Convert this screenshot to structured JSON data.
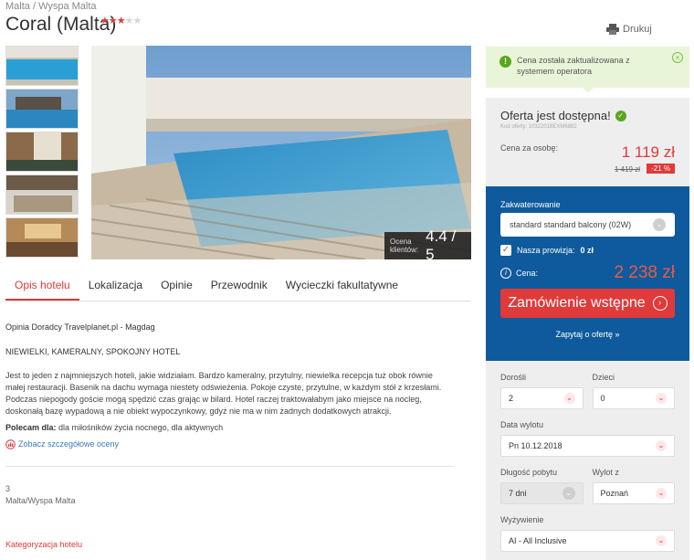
{
  "header": {
    "breadcrumb": "Malta / Wyspa Malta",
    "title": "Coral (Malta)",
    "stars_on": "★★★",
    "stars_off": "★★",
    "print_label": "Drukuj"
  },
  "gallery": {
    "rating_label": "Ocena klientów:",
    "rating_value": "4.4 / 5"
  },
  "tabs": [
    {
      "label": "Opis hotelu"
    },
    {
      "label": "Lokalizacja"
    },
    {
      "label": "Opinie"
    },
    {
      "label": "Przewodnik"
    },
    {
      "label": "Wycieczki fakultatywne"
    }
  ],
  "content": {
    "author": "Opinia Doradcy Travelplanet.pl - Magdag",
    "headline": "NIEWIELKI, KAMERALNY, SPOKOJNY HOTEL",
    "description": "Jest to jeden z najmniejszych hoteli, jakie widziałam. Bardzo kameralny, przytulny, niewielka recepcja tuż obok równie małej restauracji. Basenik na dachu wymaga niestety odświeżenia. Pokoje czyste, przytulne, w każdym stół z krzesłami. Podczas niepogody goście mogą spędzić czas grając w bilard. Hotel raczej traktowałabym jako miejsce na nocleg, doskonałą bazę wypadową a nie obiekt wypoczynkowy, gdyż nie ma w nim żadnych dodatkowych atrakcji.",
    "recommend_label": "Polecam dla:",
    "recommend_value": "dla miłośników życia nocnego, dla aktywnych",
    "details_link": "Zobacz szczegółowe oceny",
    "category_number": "3",
    "region": "Malta/Wyspa Malta",
    "category_heading": "Kategoryzacja hotelu"
  },
  "notice": {
    "text": "Cena została zaktualizowana z systemem operatora"
  },
  "offer": {
    "title": "Oferta jest dostępna!",
    "code": "Kod oferty: 10322018EXM6882",
    "per_person_label": "Cena za osobę:",
    "price": "1 119 zł",
    "old_price": "1 419 zł",
    "discount": "-21 %"
  },
  "booking": {
    "board_label": "Zakwaterowanie",
    "board_value": "standard standard balcony (02W)",
    "commission_label": "Nasza prowizja:",
    "commission_value": "0 zł",
    "total_label": "Cena:",
    "total_value": "2 238 zł",
    "order_button": "Zamówienie wstępne",
    "ask_link": "Zapytaj o ofertę »"
  },
  "filters": {
    "adults_label": "Dorośli",
    "adults_value": "2",
    "children_label": "Dzieci",
    "children_value": "0",
    "departure_label": "Data wylotu",
    "departure_value": "Pn 10.12.2018",
    "duration_label": "Długość pobytu",
    "duration_value": "7 dni",
    "from_label": "Wylot z",
    "from_value": "Poznań",
    "meal_label": "Wyżywienie",
    "meal_value": "AI - All Inclusive"
  },
  "colors": {
    "accent_red": "#e03a3a",
    "booking_blue": "#0f5a9c",
    "notice_green": "#e9f5d9"
  }
}
